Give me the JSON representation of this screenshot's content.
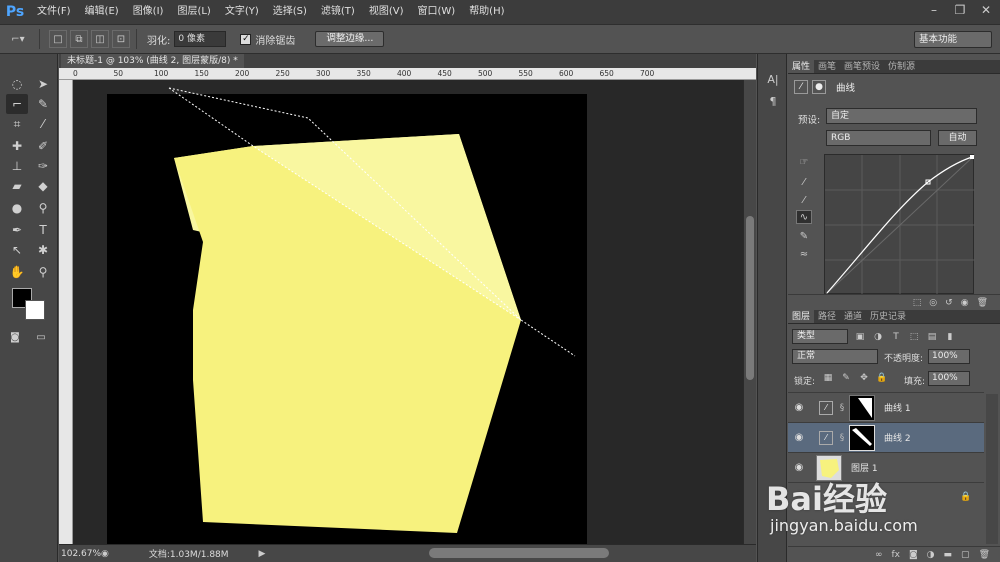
{
  "app": {
    "logo": "Ps"
  },
  "menu": [
    "文件(F)",
    "编辑(E)",
    "图像(I)",
    "图层(L)",
    "文字(Y)",
    "选择(S)",
    "滤镜(T)",
    "视图(V)",
    "窗口(W)",
    "帮助(H)"
  ],
  "options": {
    "feather_label": "羽化:",
    "feather_value": "0 像素",
    "antialias_label": "消除锯齿",
    "refine_button": "调整边缘...",
    "workspace": "基本功能"
  },
  "document": {
    "tab_title": "未标题-1 @ 103% (曲线 2, 图层蒙版/8) *",
    "zoom": "102.67%",
    "info": "文档:1.03M/1.88M",
    "ruler_h": [
      "0",
      "50",
      "100",
      "150",
      "200",
      "250",
      "300",
      "350",
      "400",
      "450",
      "500",
      "550",
      "600",
      "650",
      "700"
    ]
  },
  "colors": {
    "accent": "#4ea5ff",
    "canvas_bg": "#000000",
    "shape_main": "#f7f27e",
    "shape_light": "#f9f7a0",
    "selected_layer": "#5a6a7e"
  },
  "properties": {
    "tabs": [
      "属性",
      "画笔",
      "画笔预设",
      "仿制源"
    ],
    "title": "曲线",
    "preset_label": "预设:",
    "preset_value": "自定",
    "channel": "RGB",
    "auto_button": "自动"
  },
  "layers": {
    "tabs": [
      "图层",
      "路径",
      "通道",
      "历史记录"
    ],
    "kind": "类型",
    "blend": "正常",
    "opacity_label": "不透明度:",
    "opacity": "100%",
    "lock_label": "锁定:",
    "fill_label": "填充:",
    "fill": "100%",
    "items": [
      {
        "name": "曲线 1",
        "visible": true,
        "selected": false
      },
      {
        "name": "曲线 2",
        "visible": true,
        "selected": true
      },
      {
        "name": "图层 1",
        "visible": true,
        "selected": false
      }
    ]
  },
  "watermark": {
    "logo": "Bai经验",
    "url": "jingyan.baidu.com"
  }
}
